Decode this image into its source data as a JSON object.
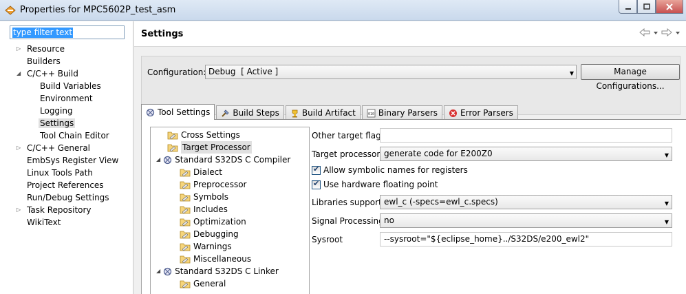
{
  "window": {
    "title": "Properties for MPC5602P_test_asm"
  },
  "filter": {
    "placeholder": "type filter text"
  },
  "nav_tree": [
    {
      "label": "Resource",
      "twist": "▷"
    },
    {
      "label": "Builders"
    },
    {
      "label": "C/C++ Build",
      "twist": "◢"
    },
    {
      "label": "Build Variables"
    },
    {
      "label": "Environment"
    },
    {
      "label": "Logging"
    },
    {
      "label": "Settings"
    },
    {
      "label": "Tool Chain Editor"
    },
    {
      "label": "C/C++ General",
      "twist": "▷"
    },
    {
      "label": "EmbSys Register View"
    },
    {
      "label": "Linux Tools Path"
    },
    {
      "label": "Project References"
    },
    {
      "label": "Run/Debug Settings"
    },
    {
      "label": "Task Repository",
      "twist": "▷"
    },
    {
      "label": "WikiText"
    }
  ],
  "header": {
    "title": "Settings"
  },
  "configuration": {
    "label": "Configuration:",
    "value": "Debug  [ Active ]",
    "manage_label": "Manage Configurations..."
  },
  "tabs": [
    {
      "label": "Tool Settings"
    },
    {
      "label": "Build Steps"
    },
    {
      "label": "Build Artifact"
    },
    {
      "label": "Binary Parsers"
    },
    {
      "label": "Error Parsers"
    }
  ],
  "tool_tree": [
    {
      "label": "Cross Settings"
    },
    {
      "label": "Target Processor"
    },
    {
      "label": "Standard S32DS C Compiler"
    },
    {
      "label": "Dialect"
    },
    {
      "label": "Preprocessor"
    },
    {
      "label": "Symbols"
    },
    {
      "label": "Includes"
    },
    {
      "label": "Optimization"
    },
    {
      "label": "Debugging"
    },
    {
      "label": "Warnings"
    },
    {
      "label": "Miscellaneous"
    },
    {
      "label": "Standard S32DS C Linker"
    },
    {
      "label": "General"
    }
  ],
  "form": {
    "other_flags_label": "Other target flags",
    "other_flags_value": "",
    "target_processor_label": "Target processor",
    "target_processor_value": "generate code for E200Z0",
    "symbolic_names_label": "Allow symbolic names for registers",
    "hw_float_label": "Use hardware floating point",
    "libraries_label": "Libraries support",
    "libraries_value": "ewl_c (-specs=ewl_c.specs)",
    "signal_label": "Signal Processing",
    "signal_value": "no",
    "sysroot_label": "Sysroot",
    "sysroot_value": "--sysroot=\"${eclipse_home}../S32DS/e200_ewl2\""
  }
}
